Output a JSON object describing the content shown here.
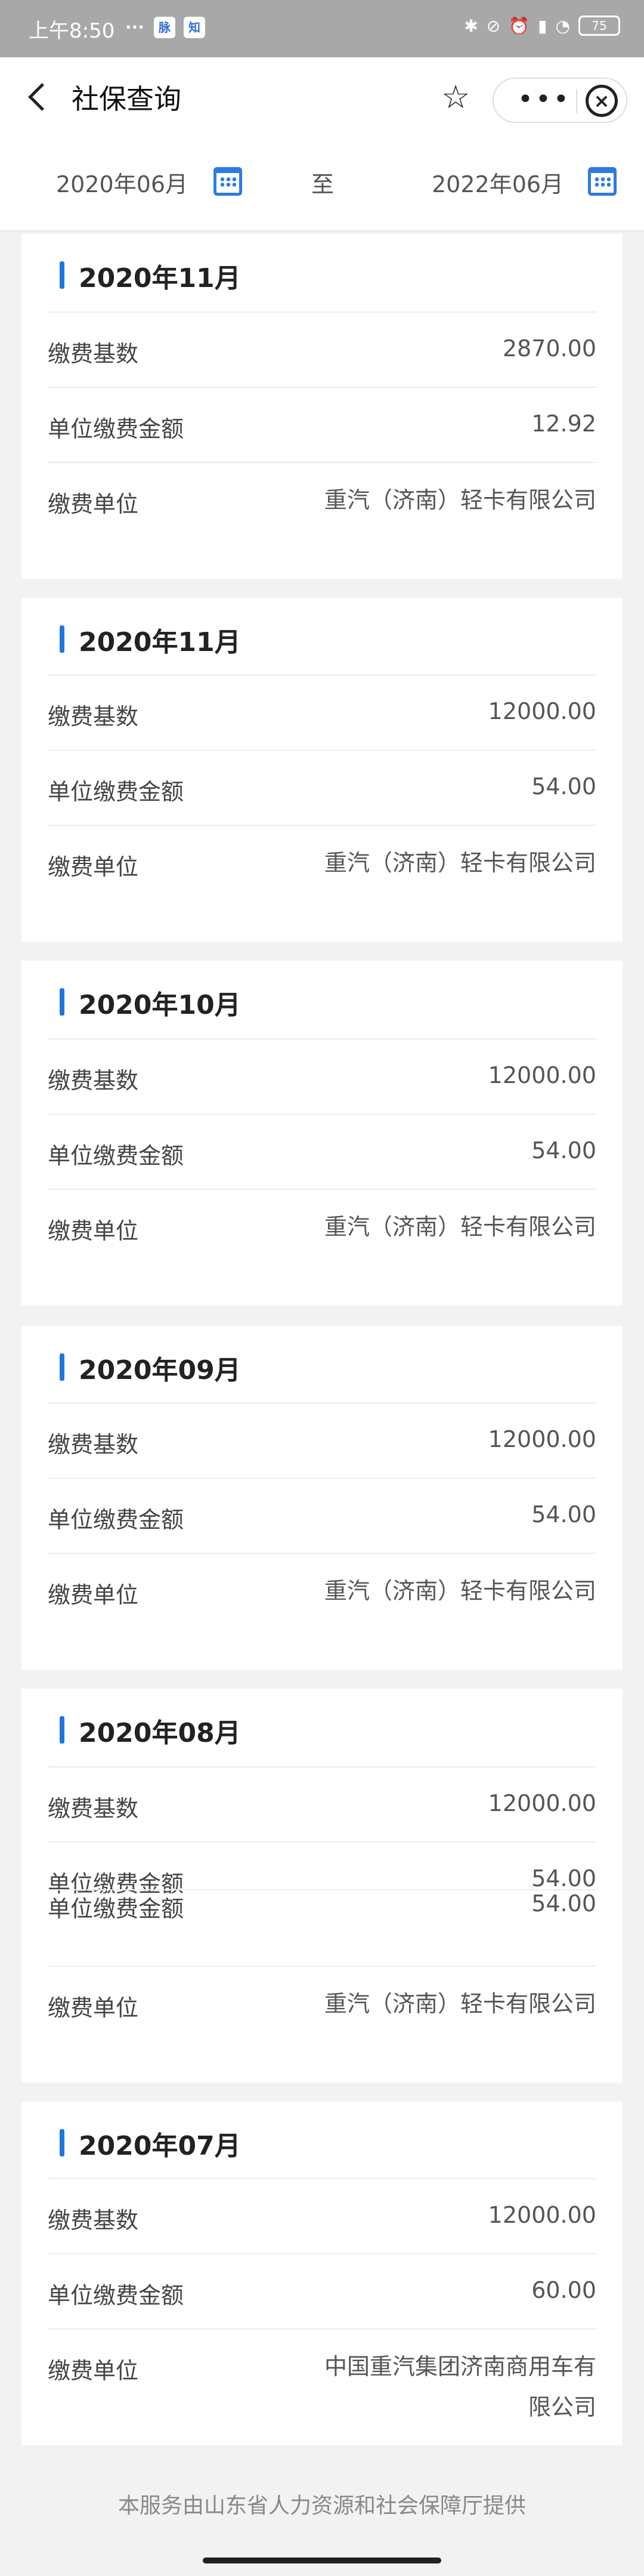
{
  "status": {
    "time": "上午8:50",
    "icons": [
      "msg-icon",
      "mai-icon",
      "zhi-icon"
    ],
    "mai_label": "脉",
    "zhi_label": "知",
    "msg_glyph": "···",
    "battery": "75"
  },
  "nav": {
    "title": "社保查询"
  },
  "dates": {
    "start": "2020年06月",
    "to_label": "至",
    "end": "2022年06月"
  },
  "records": [
    {
      "month": "2020年11月",
      "base_label": "缴费基数",
      "base": "2870.00",
      "amount_label": "单位缴费金额",
      "amount": "12.92",
      "unit_label": "缴费单位",
      "unit": "重汽（济南）轻卡有限公司"
    },
    {
      "month": "2020年11月",
      "base_label": "缴费基数",
      "base": "12000.00",
      "amount_label": "单位缴费金额",
      "amount": "54.00",
      "unit_label": "缴费单位",
      "unit": "重汽（济南）轻卡有限公司"
    },
    {
      "month": "2020年10月",
      "base_label": "缴费基数",
      "base": "12000.00",
      "amount_label": "单位缴费金额",
      "amount": "54.00",
      "unit_label": "缴费单位",
      "unit": "重汽（济南）轻卡有限公司"
    },
    {
      "month": "2020年09月",
      "base_label": "缴费基数",
      "base": "12000.00",
      "amount_label": "单位缴费金额",
      "amount": "54.00",
      "unit_label": "缴费单位",
      "unit": "重汽（济南）轻卡有限公司"
    },
    {
      "month": "2020年08月",
      "base_label": "缴费基数",
      "base": "12000.00",
      "amount_label": "单位缴费金额",
      "amount": "54.00",
      "amount2_label": "单位缴费金额",
      "amount2": "54.00",
      "unit_label": "缴费单位",
      "unit": "重汽（济南）轻卡有限公司"
    },
    {
      "month": "2020年07月",
      "base_label": "缴费基数",
      "base": "12000.00",
      "amount_label": "单位缴费金额",
      "amount": "60.00",
      "unit_label": "缴费单位",
      "unit": "中国重汽集团济南商用车有限公司"
    }
  ],
  "footer": "本服务由山东省人力资源和社会保障厅提供",
  "colors": {
    "accent": "#1e76e0",
    "calendar": "#2d7be0"
  }
}
